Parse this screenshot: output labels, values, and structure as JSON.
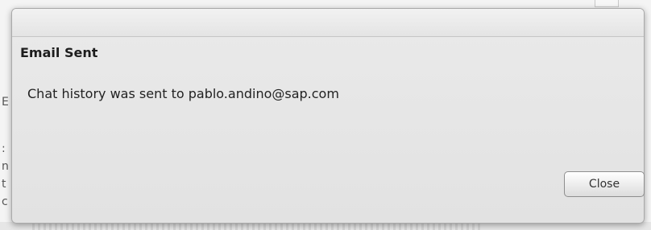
{
  "dialog": {
    "title": "Email Sent",
    "message": "Chat history was sent to pablo.andino@sap.com",
    "close_label": "Close"
  },
  "background": {
    "left_edge_chars": [
      "E",
      ":",
      "n",
      "t",
      "c"
    ]
  }
}
